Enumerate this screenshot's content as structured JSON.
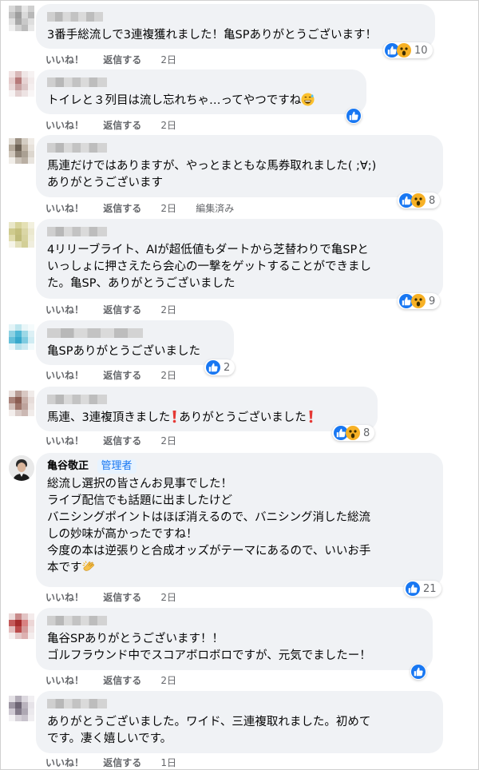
{
  "labels": {
    "like": "いいね！",
    "reply": "返信する"
  },
  "comments": [
    {
      "text": "3番手総流しで3連複獲れました！亀SPありがとうございます！",
      "time": "2日",
      "reaction_count": "10"
    },
    {
      "text": "トイレと３列目は流し忘れちゃ…ってやつですね",
      "emoji": "grinning-sweat",
      "time": "2日"
    },
    {
      "text": "馬連だけではありますが、やっとまともな馬券取れました( ;∀;)\nありがとうございます",
      "time": "2日",
      "edited": "編集済み",
      "reaction_count": "8"
    },
    {
      "text": "4リリーブライト、AIが超低値もダートから芝替わりで亀SPと\nいっしょに押さえたら会心の一撃をゲットすることができまし\nた。亀SP、ありがとうございました",
      "time": "2日",
      "reaction_count": "9"
    },
    {
      "text": "亀SPありがとうございました",
      "time": "2日",
      "reaction_count": "2"
    },
    {
      "text_a": "馬連、3連複頂きました",
      "text_b": "ありがとうございました",
      "time": "2日",
      "reaction_count": "8"
    },
    {
      "author": "亀谷敬正",
      "badge": "管理者",
      "text": "総流し選択の皆さんお見事でした！\nライブ配信でも話題に出ましたけど\nバニシングポイントはほぼ消えるので、バニシング消した総流\nしの妙味が高かったですね！\n今度の本は逆張りと合成オッズがテーマにあるので、いいお手\n本です",
      "time": "2日",
      "reaction_count": "21"
    },
    {
      "text": "亀谷SPありがとうございます！！\nゴルフラウンド中でスコアボロボロですが、元気でましたー！",
      "time": "2日"
    },
    {
      "text": "ありがとうございました。ワイド、三連複取れました。初めて\nです。凄く嬉しいです。",
      "time": "1日"
    }
  ],
  "icons": [
    "like-icon",
    "wow-icon",
    "grinning-sweat-emoji",
    "clapping-hands-emoji",
    "red-exclamation-emoji"
  ],
  "colors": {
    "like": "#1877f2",
    "wow": "#f7b125",
    "bubble": "#f0f2f5",
    "admin_badge": "#1877f2",
    "meta": "#65676b"
  }
}
